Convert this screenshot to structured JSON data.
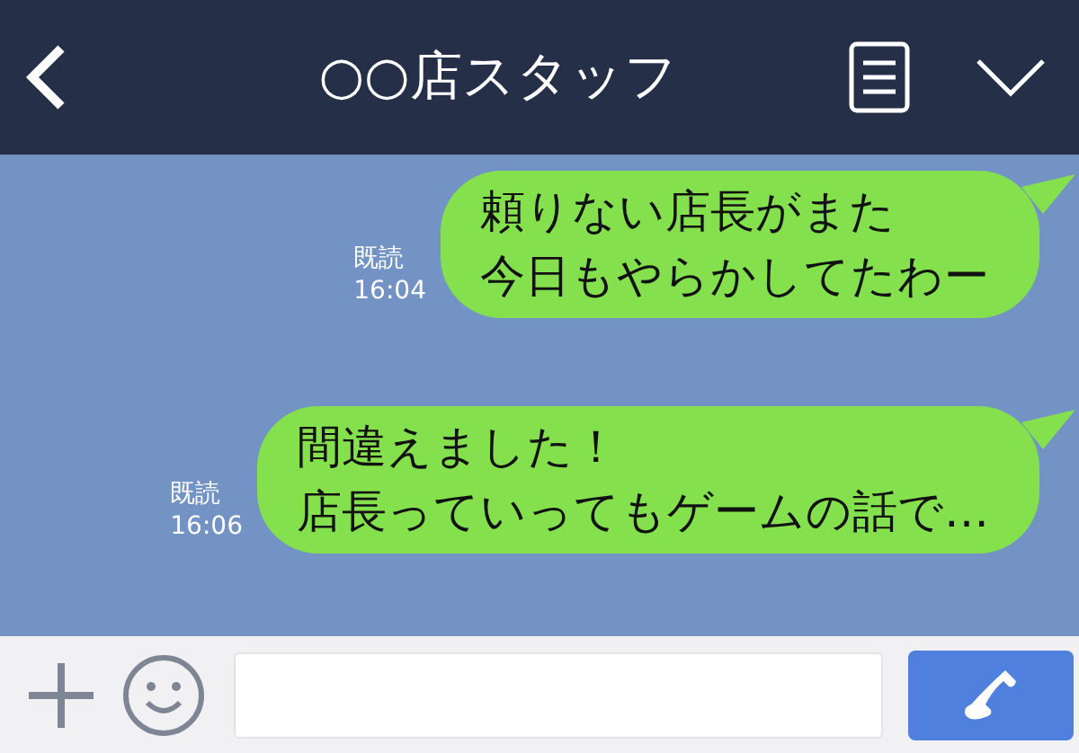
{
  "header": {
    "title": "○○店スタッフ"
  },
  "messages": [
    {
      "lines": [
        "頼りない店長がまた",
        "今日もやらかしてたわー"
      ],
      "read": "既読",
      "time": "16:04"
    },
    {
      "lines": [
        "間違えました！",
        "店長っていってもゲームの話で…"
      ],
      "read": "既読",
      "time": "16:06"
    }
  ]
}
